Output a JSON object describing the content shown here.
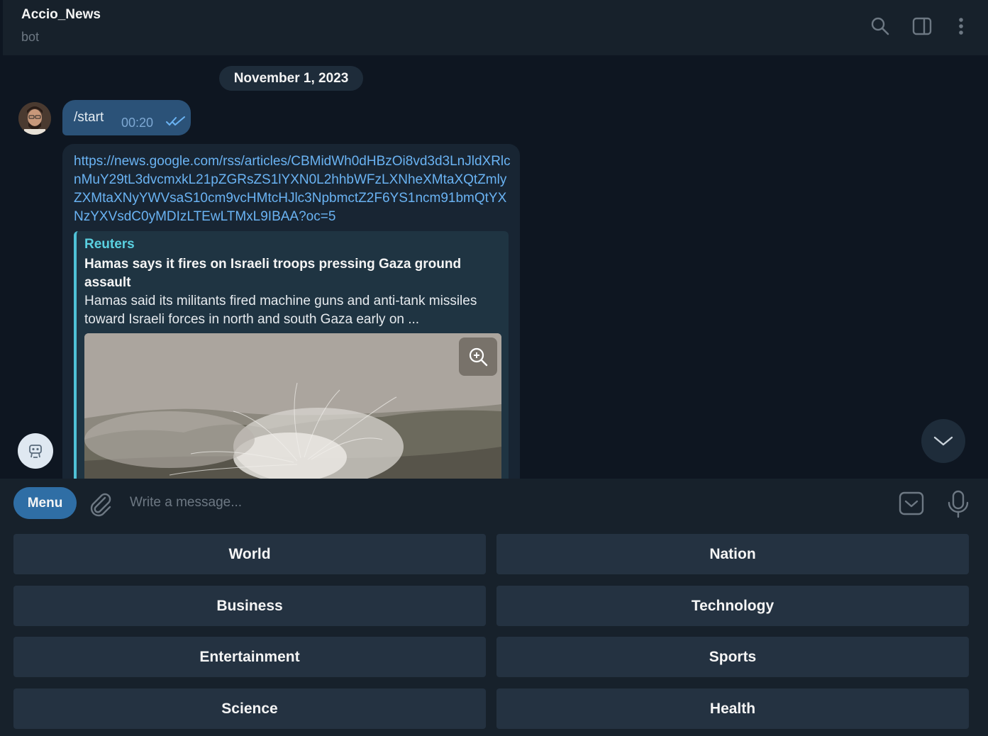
{
  "header": {
    "title": "Accio_News",
    "subtitle": "bot",
    "icons": [
      "search-icon",
      "sidebar-toggle-icon",
      "more-vertical-icon"
    ]
  },
  "chat": {
    "date": "November 1, 2023",
    "user_message": {
      "text": "/start",
      "time": "00:20",
      "status": "read"
    },
    "bot_message": {
      "link": "https://news.google.com/rss/articles/CBMidWh0dHBzOi8vd3d3LnJldXRlcnMuY29tL3dvcmxkL21pZGRsZS1lYXN0L2hhbWFzLXNheXMtaXQtZmlyZXMtaXNyYWVsaS10cm9vcHMtcHJlc3NpbmctZ2F6YS1ncm91bmQtYXNzYXVsdC0yMDIzLTEwLTMxL9IBAA?oc=5",
      "preview": {
        "source": "Reuters",
        "headline": "Hamas says it fires on Israeli troops pressing Gaza ground assault",
        "description": "Hamas said its militants fired machine guns and anti-tank missiles toward Israeli forces in north and south Gaza early on ..."
      }
    }
  },
  "composer": {
    "menu_label": "Menu",
    "placeholder": "Write a message..."
  },
  "keyboard": [
    [
      "World",
      "Nation"
    ],
    [
      "Business",
      "Technology"
    ],
    [
      "Entertainment",
      "Sports"
    ],
    [
      "Science",
      "Health"
    ]
  ],
  "colors": {
    "background": "#0e1621",
    "panel": "#17212b",
    "outgoing_bubble": "#2b5278",
    "incoming_bubble": "#182533",
    "link": "#6ab3f3",
    "accent": "#2f6ea5",
    "preview_bar": "#4fc1d6"
  }
}
